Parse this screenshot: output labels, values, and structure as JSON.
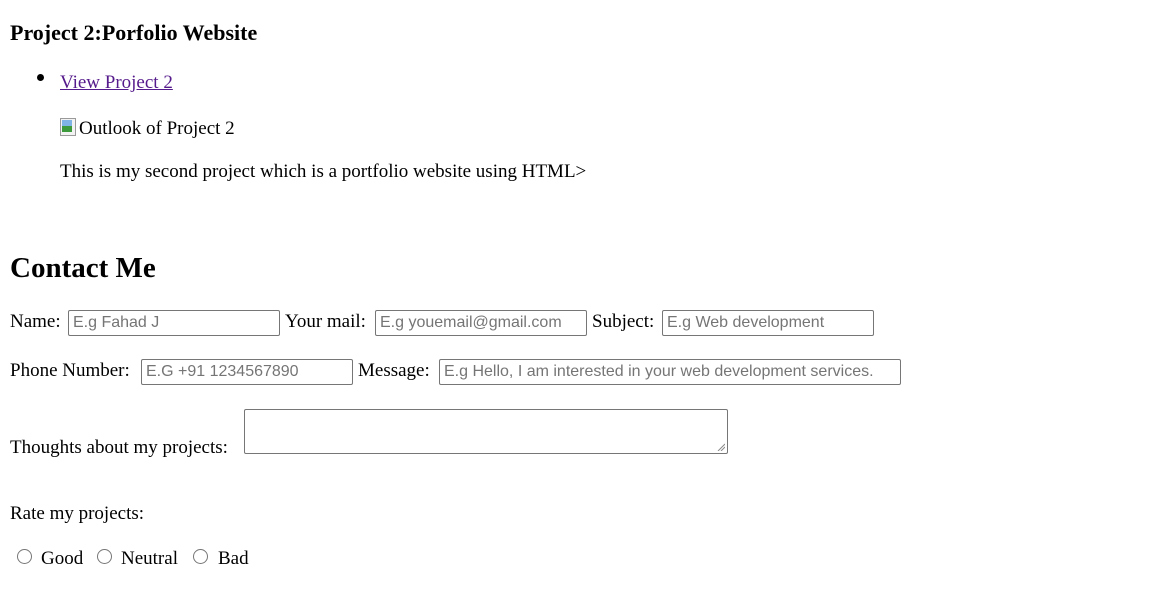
{
  "project": {
    "heading": "Project 2:Porfolio Website",
    "link_text": "View Project 2",
    "image_alt": "Outlook of Project 2",
    "description": "This is my second project which is a portfolio website using HTML>"
  },
  "contact": {
    "heading": "Contact Me",
    "name_label": "Name:",
    "name_placeholder": "E.g Fahad J",
    "mail_label": "Your mail:",
    "mail_placeholder": "E.g youemail@gmail.com",
    "subject_label": "Subject:",
    "subject_placeholder": "E.g Web development",
    "phone_label": "Phone Number:",
    "phone_placeholder": "E.G +91 1234567890",
    "message_label": "Message:",
    "message_placeholder": "E.g Hello, I am interested in your web development services.",
    "thoughts_label": "Thoughts about my projects:",
    "thoughts_value": "",
    "rate_label": "Rate my projects:",
    "rate_options": [
      "Good",
      "Neutral",
      "Bad"
    ]
  }
}
